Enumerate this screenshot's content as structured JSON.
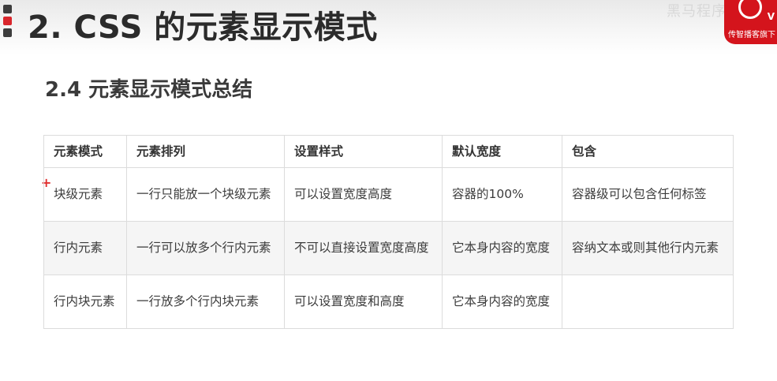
{
  "slide": {
    "title": "2. CSS 的元素显示模式",
    "bullet_colors": [
      "#3d3d3d",
      "#d9262c",
      "#3d3d3d"
    ]
  },
  "watermark": {
    "text": "黑马程序员"
  },
  "logo": {
    "letter": "V",
    "tagline": "传智播客旗下"
  },
  "section": {
    "heading": "2.4 元素显示模式总结"
  },
  "annotation": {
    "plus": "+"
  },
  "table": {
    "headers": [
      "元素模式",
      "元素排列",
      "设置样式",
      "默认宽度",
      "包含"
    ],
    "rows": [
      [
        "块级元素",
        "一行只能放一个块级元素",
        "可以设置宽度高度",
        "容器的100%",
        "容器级可以包含任何标签"
      ],
      [
        "行内元素",
        "一行可以放多个行内元素",
        "不可以直接设置宽度高度",
        "它本身内容的宽度",
        "容纳文本或则其他行内元素"
      ],
      [
        "行内块元素",
        "一行放多个行内块元素",
        "可以设置宽度和高度",
        "它本身内容的宽度",
        ""
      ]
    ]
  }
}
